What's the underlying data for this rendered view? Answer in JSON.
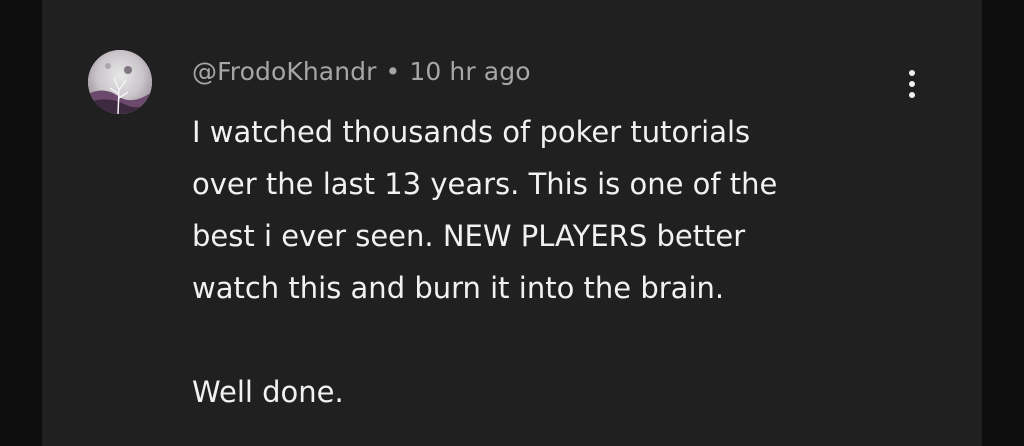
{
  "comment": {
    "author": "@FrodoKhandr",
    "separator": "•",
    "time": "10 hr ago",
    "avatar_icon": "avatar-image",
    "more_icon": "more-vert-icon",
    "text_lines": [
      "I watched thousands of poker tutorials",
      "over the last 13 years. This is one of the",
      "best i ever seen. NEW PLAYERS better",
      "watch this and burn it into the brain.",
      "",
      "Well done."
    ]
  },
  "colors": {
    "background": "#202020",
    "side_background": "#0e0e0e",
    "meta_text": "#a6a6a6",
    "body_text": "#f1f1f1"
  }
}
